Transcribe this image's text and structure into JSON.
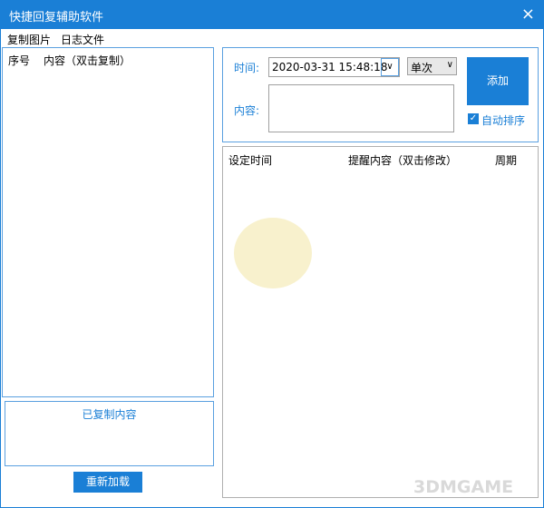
{
  "window": {
    "title": "快捷回复辅助软件",
    "close_icon": "×"
  },
  "menu": [
    "复制图片",
    "日志文件"
  ],
  "left_list": {
    "col_index": "序号",
    "col_content": "内容（双击复制）"
  },
  "copied": {
    "label": "已复制内容"
  },
  "reload_label": "重新加载",
  "form": {
    "time_label": "时间:",
    "time_value": "2020-03-31 15:48:18",
    "period_value": "单次",
    "content_label": "内容:",
    "content_value": "",
    "add_label": "添加",
    "auto_sort_label": "自动排序",
    "auto_sort_checked": true
  },
  "reminders": {
    "col_time": "设定时间",
    "col_content": "提醒内容（双击修改）",
    "col_period": "周期"
  },
  "watermark": "3DMGAME",
  "colors": {
    "accent": "#1a7fd6"
  }
}
